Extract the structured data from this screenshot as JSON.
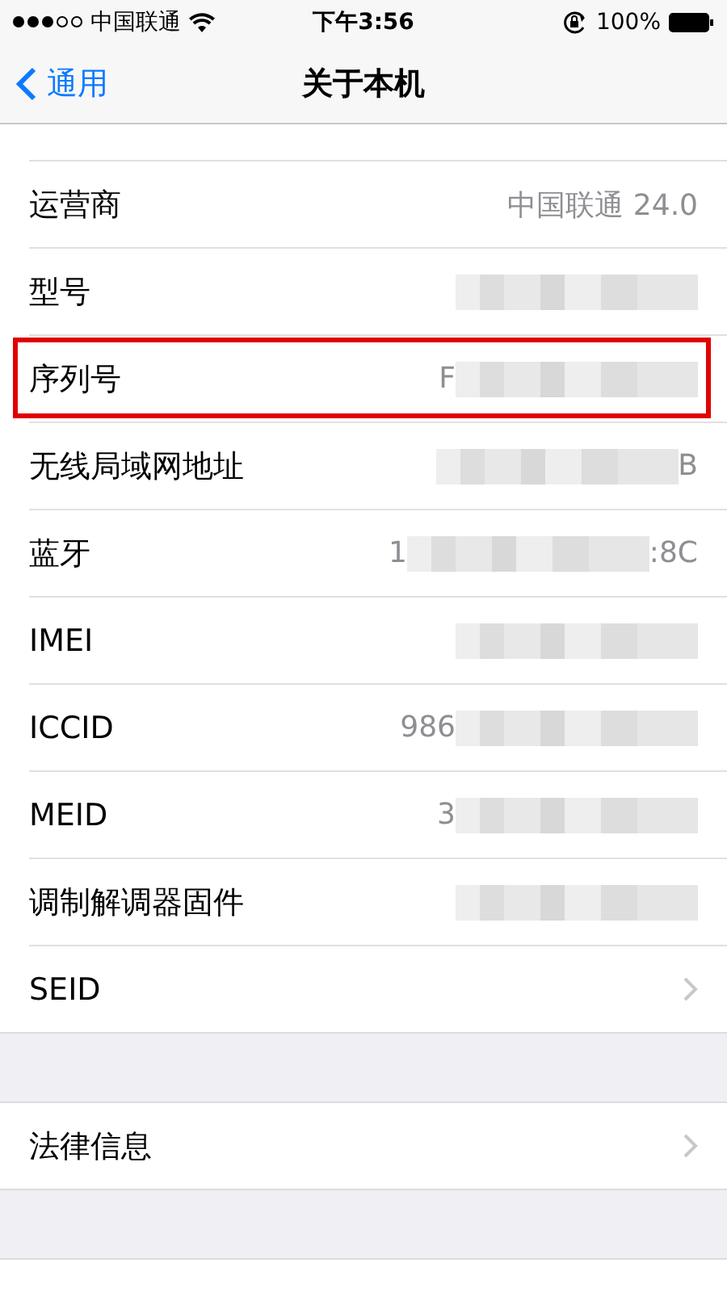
{
  "status_bar": {
    "carrier": "中国联通",
    "signal_dots": [
      true,
      true,
      true,
      false,
      false
    ],
    "time": "下午3:56",
    "battery": "100%"
  },
  "nav": {
    "back": "通用",
    "title": "关于本机"
  },
  "sections": [
    {
      "rows": [
        {
          "label": "运营商",
          "value": "中国联通 24.0",
          "redacted": false,
          "chevron": false,
          "highlighted": false
        },
        {
          "label": "型号",
          "redacted": true,
          "chevron": false,
          "highlighted": false
        },
        {
          "label": "序列号",
          "value_start": "F",
          "redacted": true,
          "chevron": false,
          "highlighted": true
        },
        {
          "label": "无线局域网地址",
          "value_end": "B",
          "redacted": true,
          "chevron": false,
          "highlighted": false
        },
        {
          "label": "蓝牙",
          "value_start": "1",
          "value_end": ":8C",
          "redacted": true,
          "chevron": false,
          "highlighted": false
        },
        {
          "label": "IMEI",
          "redacted": true,
          "chevron": false,
          "highlighted": false
        },
        {
          "label": "ICCID",
          "value_start": "986",
          "redacted": true,
          "chevron": false,
          "highlighted": false
        },
        {
          "label": "MEID",
          "value_start": "3",
          "redacted": true,
          "chevron": false,
          "highlighted": false
        },
        {
          "label": "调制解调器固件",
          "redacted": true,
          "chevron": false,
          "highlighted": false
        },
        {
          "label": "SEID",
          "redacted": false,
          "chevron": true,
          "highlighted": false
        }
      ]
    },
    {
      "rows": [
        {
          "label": "法律信息",
          "redacted": false,
          "chevron": true,
          "highlighted": false
        }
      ]
    }
  ]
}
